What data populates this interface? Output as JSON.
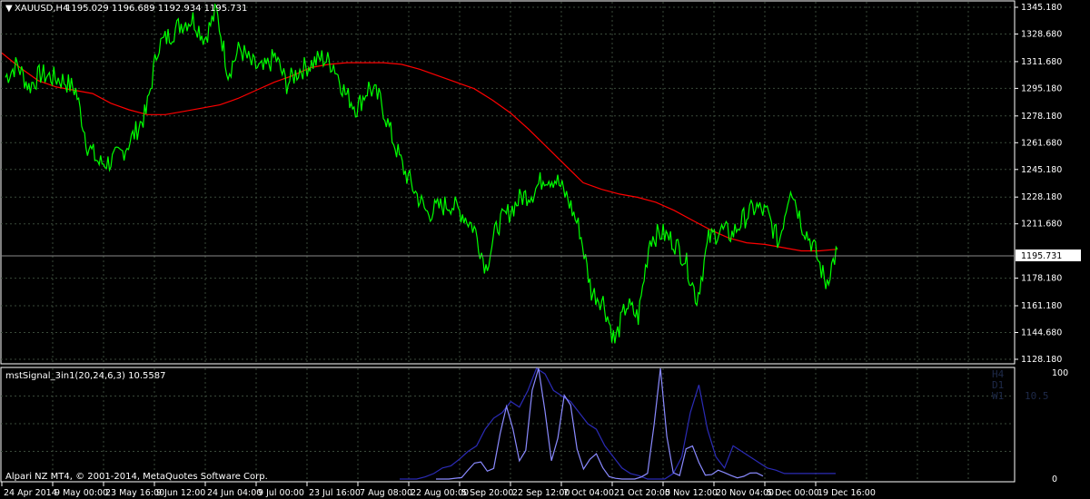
{
  "main_chart": {
    "title": "XAUUSD,H4",
    "ohlc": "1195.029 1196.689 1192.934 1195.731",
    "current_price": "1195.731",
    "price_labels": [
      "1345.180",
      "1328.680",
      "1311.680",
      "1295.180",
      "1278.180",
      "1261.680",
      "1245.180",
      "1228.180",
      "1211.680",
      "1178.180",
      "1161.180",
      "1144.680",
      "1128.180"
    ],
    "colors": {
      "price": "#00ff00",
      "ma": "#ff0000",
      "grid": "#3a4a3a"
    }
  },
  "indicator": {
    "title": "mstSignal_3in1(20,24,6,3) 10.5587",
    "scale_top": "100",
    "scale_bottom": "0",
    "panel_labels": [
      "H4",
      "D1",
      "W1",
      "10.5"
    ],
    "colors": {
      "line1": "#2b2bb5",
      "line2": "#8a8aff"
    }
  },
  "footer": {
    "copyright": "Alpari NZ MT4, © 2001-2014, MetaQuotes Software Corp."
  },
  "time_labels": [
    "24 Apr 2014",
    "9 May 00:00",
    "23 May 16:00",
    "9 Jun 12:00",
    "24 Jun 04:00",
    "9 Jul 00:00",
    "23 Jul 16:00",
    "7 Aug 08:00",
    "22 Aug 00:00",
    "5 Sep 20:00",
    "22 Sep 12:00",
    "7 Oct 04:00",
    "21 Oct 20:00",
    "5 Nov 12:00",
    "20 Nov 04:00",
    "5 Dec 00:00",
    "19 Dec 16:00"
  ],
  "chart_data": {
    "type": "line",
    "series": [
      {
        "name": "XAUUSD,H4",
        "values": [
          1302,
          1310,
          1296,
          1304,
          1302,
          1300,
          1294,
          1260,
          1249,
          1250,
          1256,
          1267,
          1280,
          1321,
          1328,
          1335,
          1338,
          1326,
          1343,
          1305,
          1320,
          1310,
          1306,
          1315,
          1298,
          1306,
          1310,
          1314,
          1310,
          1292,
          1283,
          1296,
          1288,
          1265,
          1245,
          1231,
          1218,
          1222,
          1224,
          1218,
          1209,
          1185,
          1211,
          1219,
          1228,
          1231,
          1241,
          1239,
          1227,
          1208,
          1170,
          1164,
          1139,
          1162,
          1154,
          1203,
          1206,
          1201,
          1190,
          1165,
          1202,
          1208,
          1205,
          1215,
          1222,
          1218,
          1200,
          1236,
          1211,
          1197,
          1175,
          1196
        ]
      },
      {
        "name": "MA",
        "values": [
          1317,
          1308,
          1300,
          1296,
          1294,
          1292,
          1286,
          1282,
          1279,
          1279,
          1281,
          1283,
          1285,
          1289,
          1294,
          1299,
          1303,
          1308,
          1310,
          1311,
          1311,
          1311,
          1310,
          1307,
          1303,
          1299,
          1295,
          1288,
          1280,
          1270,
          1259,
          1248,
          1237,
          1233,
          1230,
          1228,
          1225,
          1220,
          1214,
          1208,
          1203,
          1200,
          1199,
          1197,
          1195,
          1195,
          1196
        ]
      },
      {
        "name": "mstSignal_3in1(20,24,6,3)",
        "values": [
          0,
          0,
          0,
          2,
          5,
          10,
          12,
          18,
          25,
          30,
          45,
          55,
          60,
          70,
          65,
          80,
          100,
          95,
          80,
          75,
          70,
          60,
          50,
          45,
          30,
          20,
          10,
          5,
          3,
          0,
          0,
          0,
          5,
          20,
          60,
          85,
          45,
          20,
          10,
          30,
          25,
          20,
          15,
          10,
          8,
          5,
          5,
          5,
          5,
          5,
          5,
          5
        ]
      }
    ]
  }
}
